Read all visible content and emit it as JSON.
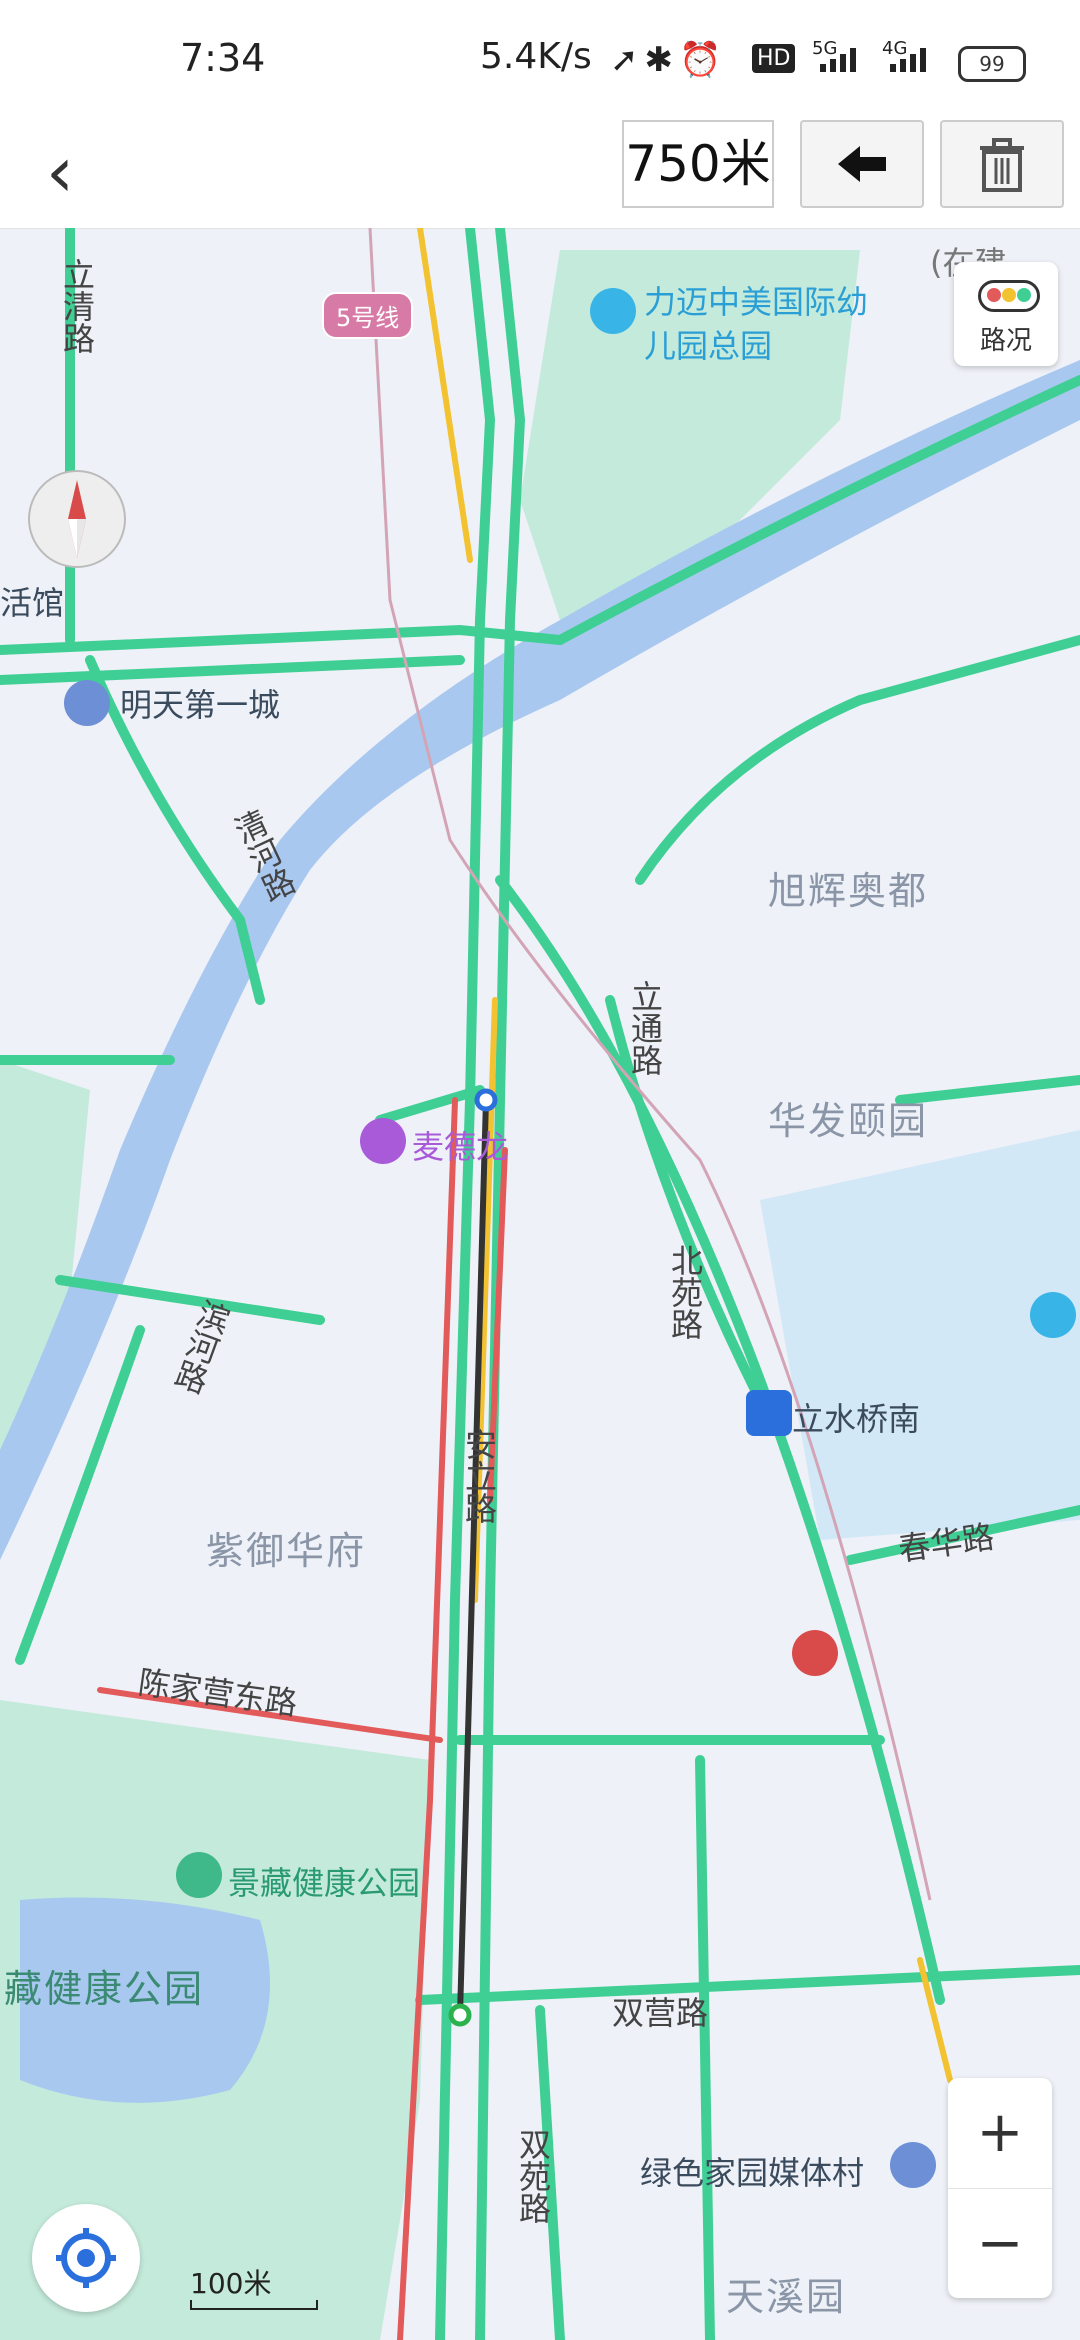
{
  "status_bar": {
    "time": "7:34",
    "net_speed": "5.4K/s",
    "hd_badge": "HD",
    "network_1": "5G",
    "network_2": "4G",
    "battery": "99",
    "icons": [
      "location-arrow-icon",
      "bluetooth-icon",
      "alarm-icon"
    ]
  },
  "toolbar": {
    "back_icon": "chevron-left-icon",
    "distance": "750米",
    "undo_icon": "arrow-left-icon",
    "delete_icon": "trash-icon"
  },
  "map": {
    "colors": {
      "water": "#a9c8f0",
      "park": "#c4eadb",
      "road_free": "#3fcf94",
      "road_slow": "#f2c230",
      "road_jam": "#e35a5a",
      "measure_line": "#333333"
    },
    "metro_badge": "5号线",
    "labels": {
      "top_right_partial": "(在建",
      "lichqing_road": "立清路",
      "tea_house_partial": "活馆",
      "mingtian": "明天第一城",
      "lime_kindergarten": "力迈中美国际幼儿园总园",
      "qinghe_road": "清河路",
      "xuhui": "旭辉奥都",
      "litong_road": "立通路",
      "huafa": "华发颐园",
      "mcdonalds": "麦德龙",
      "beiyuan_road": "北苑路",
      "binhe_road": "滨河路",
      "lishuiqiao_nan": "立水桥南",
      "anli_road": "安立路",
      "ziyu": "紫御华府",
      "chunhua_road": "春华路",
      "chenjiaying_east": "陈家营东路",
      "jingzang_park": "景藏健康公园",
      "jingzang_park_partial": "藏健康公园",
      "shuangying_road": "双营路",
      "shuangyuan_road": "双苑路",
      "lvse_jiayuan": "绿色家园媒体村",
      "tianxi": "天溪园"
    }
  },
  "controls": {
    "traffic_label": "路况",
    "zoom_in": "+",
    "zoom_out": "−",
    "scale_label": "100米"
  }
}
